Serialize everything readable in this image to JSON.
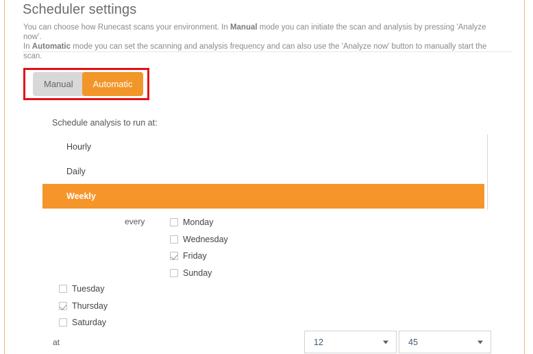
{
  "page": {
    "title": "Scheduler settings",
    "description_line1_pre": "You can choose how Runecast scans your environment. In ",
    "description_line1_bold": "Manual",
    "description_line1_post": " mode you can initiate the scan and analysis by pressing 'Analyze now'.",
    "description_line2_pre": "In ",
    "description_line2_bold": "Automatic",
    "description_line2_post": " mode you can set the scanning and analysis frequency and can also use the 'Analyze now' button to manually start the scan."
  },
  "mode_toggle": {
    "manual_label": "Manual",
    "automatic_label": "Automatic",
    "selected": "Automatic"
  },
  "schedule": {
    "label": "Schedule analysis to run at:",
    "options": [
      {
        "label": "Hourly",
        "selected": false
      },
      {
        "label": "Daily",
        "selected": false
      },
      {
        "label": "Weekly",
        "selected": true
      }
    ]
  },
  "days": {
    "every_label": "every",
    "column_a": [
      {
        "label": "Monday",
        "checked": false
      },
      {
        "label": "Wednesday",
        "checked": false
      },
      {
        "label": "Friday",
        "checked": true
      },
      {
        "label": "Sunday",
        "checked": false
      }
    ],
    "column_b": [
      {
        "label": "Tuesday",
        "checked": false
      },
      {
        "label": "Thursday",
        "checked": true
      },
      {
        "label": "Saturday",
        "checked": false
      }
    ]
  },
  "time": {
    "at_label": "at",
    "hour_value": "12",
    "minute_value": "45"
  },
  "colors": {
    "accent_orange": "#f2962a",
    "selected_row_orange": "#f5952a",
    "annotation_red": "#e50f17",
    "frame_orange": "#f0b968",
    "inactive_gray": "#d8d8d8"
  }
}
